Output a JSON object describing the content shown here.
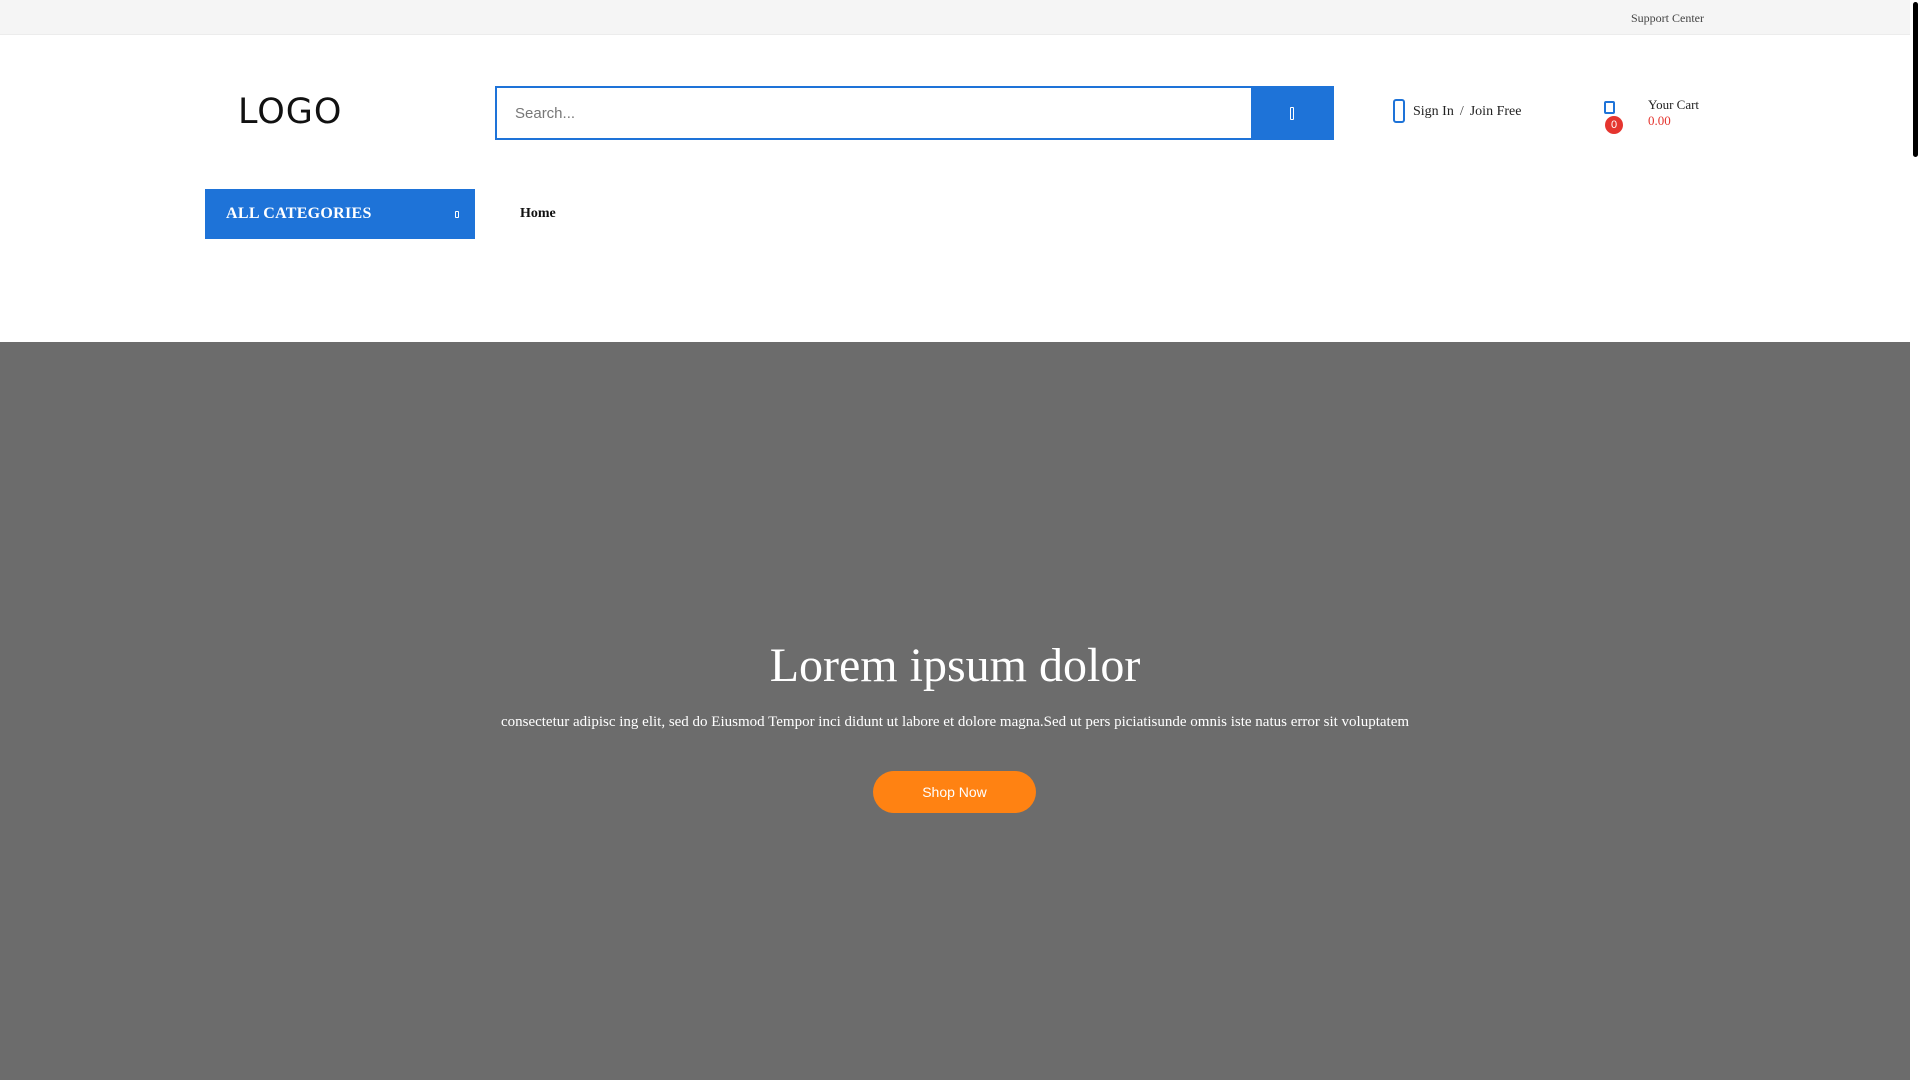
{
  "topbar": {
    "support_label": "Support Center"
  },
  "header": {
    "logo_text": "LOGO",
    "search": {
      "placeholder": "Search...",
      "value": ""
    },
    "account": {
      "sign_in": "Sign In",
      "separator": "/",
      "join": "Join Free"
    },
    "cart": {
      "count": "0",
      "label": "Your Cart",
      "amount": "0.00"
    }
  },
  "nav": {
    "categories_label": "ALL CATEGORIES",
    "items": [
      {
        "label": "Home"
      }
    ]
  },
  "hero": {
    "heading": "Lorem ipsum dolor",
    "subtitle": "consectetur adipisc ing elit, sed do Eiusmod Tempor inci didunt ut labore et dolore magna.Sed ut pers piciatisunde omnis iste natus error sit voluptatem",
    "button_label": "Shop Now"
  },
  "colors": {
    "primary": "#1e73d8",
    "accent": "#ff8212",
    "price": "#e5352f",
    "hero_bg": "#6c6c6c"
  }
}
